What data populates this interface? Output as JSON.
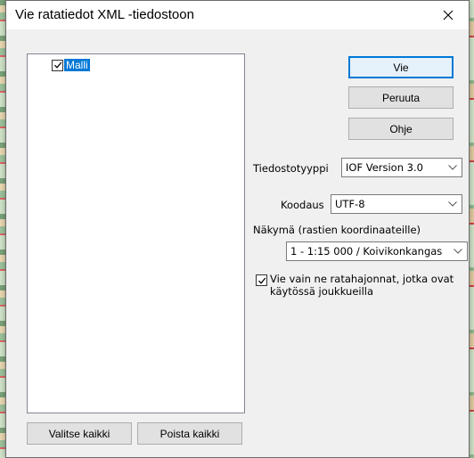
{
  "window": {
    "title": "Vie ratatiedot XML -tiedostoon"
  },
  "tree": {
    "items": [
      {
        "label": "Malli",
        "checked": true
      }
    ]
  },
  "buttons": {
    "export": "Vie",
    "cancel": "Peruuta",
    "help": "Ohje",
    "select_all": "Valitse kaikki",
    "clear_all": "Poista kaikki"
  },
  "form": {
    "filetype_label": "Tiedostotyyppi",
    "filetype_value": "IOF Version 3.0",
    "encoding_label": "Koodaus",
    "encoding_value": "UTF-8",
    "view_label": "Näkymä (rastien koordinaateille)",
    "view_value": "1 - 1:15 000 / Koivikonkangas",
    "only_used_checked": true,
    "only_used_label": "Vie vain ne ratahajonnat, jotka ovat käytössä joukkueilla"
  },
  "icons": {
    "close": "close-icon",
    "dropdown": "chevron-down-icon",
    "check": "checkmark-icon"
  },
  "colors": {
    "selection": "#0078d7",
    "dialog_bg": "#f0f0f0",
    "default_button_border": "#0078d7"
  }
}
